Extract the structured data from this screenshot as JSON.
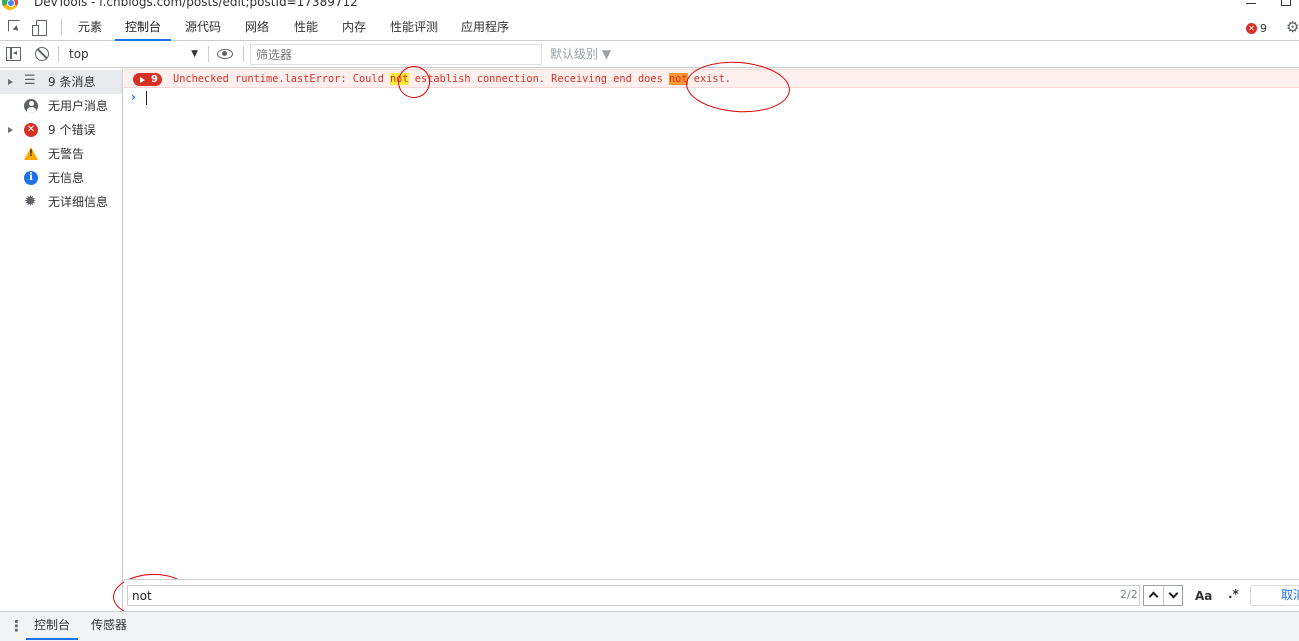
{
  "window": {
    "title": "DevTools - i.cnblogs.com/posts/edit;postId=17389712"
  },
  "tabs": [
    {
      "label": "元素"
    },
    {
      "label": "控制台",
      "active": true
    },
    {
      "label": "源代码"
    },
    {
      "label": "网络"
    },
    {
      "label": "性能"
    },
    {
      "label": "内存"
    },
    {
      "label": "性能评测"
    },
    {
      "label": "应用程序"
    }
  ],
  "error_count": "9",
  "console_toolbar": {
    "context": "top",
    "filter_placeholder": "筛选器",
    "level": "默认级别 ▼"
  },
  "sidebar": {
    "items": [
      {
        "label": "9 条消息",
        "icon": "list-icon"
      },
      {
        "label": "无用户消息",
        "icon": "user-icon"
      },
      {
        "label": "9 个错误",
        "icon": "error-icon"
      },
      {
        "label": "无警告",
        "icon": "warning-icon"
      },
      {
        "label": "无信息",
        "icon": "info-icon"
      },
      {
        "label": "无详细信息",
        "icon": "verbose-icon"
      }
    ]
  },
  "console": {
    "error_badge": "9",
    "message_parts": [
      "Unchecked runtime.lastError: Could ",
      "not",
      " establish connection. Receiving end does ",
      "not",
      " exist."
    ],
    "prompt": "›"
  },
  "search": {
    "value": "not",
    "match_count": "2/2",
    "case_label": "Aa",
    "regex_label": ".*",
    "cancel_label": "取消"
  },
  "drawer": {
    "tabs": [
      {
        "label": "控制台",
        "active": true
      },
      {
        "label": "传感器"
      }
    ]
  },
  "colors": {
    "accent": "#1a73e8",
    "error": "#d93025",
    "error_bg": "#fff0f0",
    "highlight": "#ffeb3b",
    "current_highlight": "#ff9632",
    "annotation": "#e00000"
  }
}
